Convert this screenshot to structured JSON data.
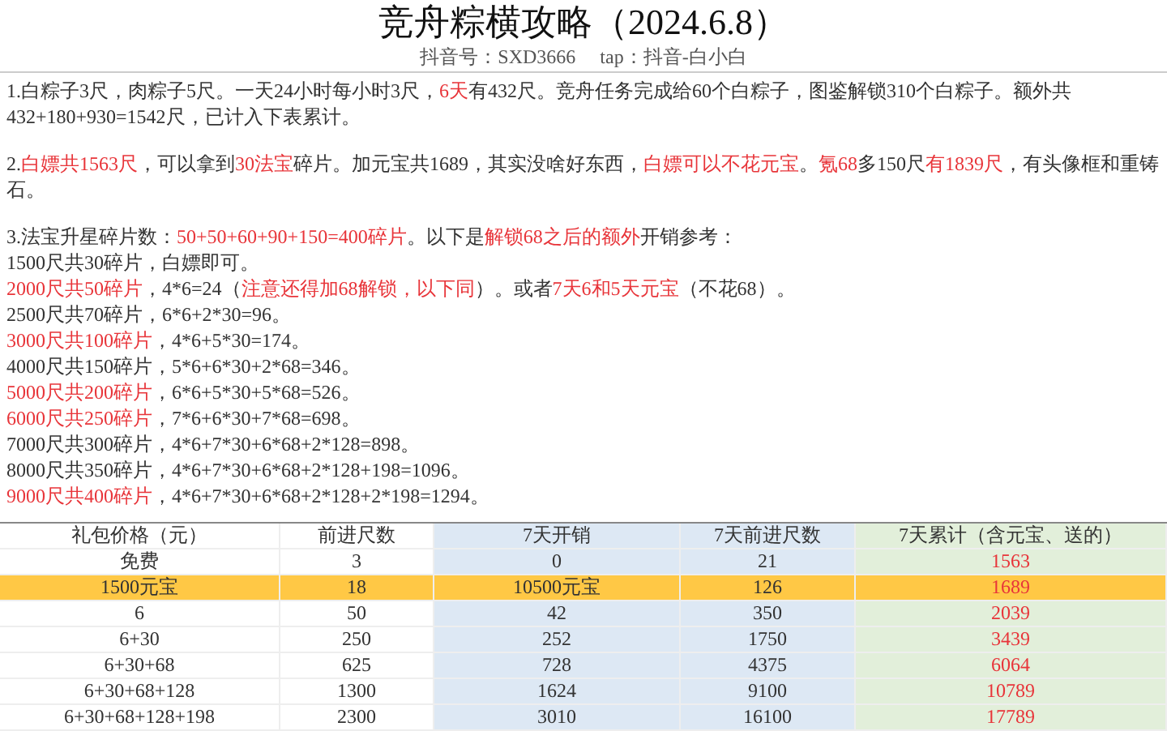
{
  "title": "竞舟粽横攻略（2024.6.8）",
  "subtitle": "抖音号：SXD3666　 tap：抖音-白小白",
  "paragraphs": [
    {
      "lines": [
        [
          {
            "text": "1.白粽子3尺，肉粽子5尺。一天24小时每小时3尺，",
            "highlight": false
          },
          {
            "text": "6天",
            "highlight": true
          },
          {
            "text": "有432尺。竞舟任务完成给60个白粽子，图鉴解锁310个白粽子。额外共432+180+930=1542尺，已计入下表累计。",
            "highlight": false
          }
        ]
      ]
    },
    {
      "lines": [
        [
          {
            "text": "2.",
            "highlight": false
          },
          {
            "text": "白嫖共1563尺",
            "highlight": true
          },
          {
            "text": "，可以拿到",
            "highlight": false
          },
          {
            "text": "30法宝",
            "highlight": true
          },
          {
            "text": "碎片。加元宝共1689，其实没啥好东西，",
            "highlight": false
          },
          {
            "text": "白嫖可以不花元宝",
            "highlight": true
          },
          {
            "text": "。",
            "highlight": false
          },
          {
            "text": "氪68",
            "highlight": true
          },
          {
            "text": "多150尺",
            "highlight": false
          },
          {
            "text": "有1839尺",
            "highlight": true
          },
          {
            "text": "，有头像框和重铸石。",
            "highlight": false
          }
        ]
      ]
    },
    {
      "lines": [
        [
          {
            "text": "3.法宝升星碎片数：",
            "highlight": false
          },
          {
            "text": "50+50+60+90+150=400碎片",
            "highlight": true
          },
          {
            "text": "。以下是",
            "highlight": false
          },
          {
            "text": "解锁68之后的额外",
            "highlight": true
          },
          {
            "text": "开销参考：",
            "highlight": false
          }
        ],
        [
          {
            "text": "1500尺共30碎片，白嫖即可。",
            "highlight": false
          }
        ],
        [
          {
            "text": "2000尺共50碎片",
            "highlight": true
          },
          {
            "text": "，4*6=24（",
            "highlight": false
          },
          {
            "text": "注意还得加68解锁，以下同",
            "highlight": true
          },
          {
            "text": "）。或者",
            "highlight": false
          },
          {
            "text": "7天6和5天元宝",
            "highlight": true
          },
          {
            "text": "（不花68）。",
            "highlight": false
          }
        ],
        [
          {
            "text": "2500尺共70碎片，6*6+2*30=96。",
            "highlight": false
          }
        ],
        [
          {
            "text": "3000尺共100碎片",
            "highlight": true
          },
          {
            "text": "，4*6+5*30=174。",
            "highlight": false
          }
        ],
        [
          {
            "text": "4000尺共150碎片，5*6+6*30+2*68=346。",
            "highlight": false
          }
        ],
        [
          {
            "text": "5000尺共200碎片",
            "highlight": true
          },
          {
            "text": "，6*6+5*30+5*68=526。",
            "highlight": false
          }
        ],
        [
          {
            "text": "6000尺共250碎片",
            "highlight": true
          },
          {
            "text": "，7*6+6*30+7*68=698。",
            "highlight": false
          }
        ],
        [
          {
            "text": "7000尺共300碎片，4*6+7*30+6*68+2*128=898。",
            "highlight": false
          }
        ],
        [
          {
            "text": "8000尺共350碎片，4*6+7*30+6*68+2*128+198=1096。",
            "highlight": false
          }
        ],
        [
          {
            "text": "9000尺共400碎片",
            "highlight": true
          },
          {
            "text": "，4*6+7*30+6*68+2*128+2*198=1294。",
            "highlight": false
          }
        ]
      ]
    }
  ],
  "table": {
    "columns": [
      {
        "label": "礼包价格（元）",
        "color": "#ffffff",
        "emphasis": false
      },
      {
        "label": "前进尺数",
        "color": "#ffffff",
        "emphasis": false
      },
      {
        "label": "7天开销",
        "color": "#dde8f4",
        "emphasis": false
      },
      {
        "label": "7天前进尺数",
        "color": "#dde8f4",
        "emphasis": false
      },
      {
        "label": "7天累计（含元宝、送的）",
        "color": "#e2efda",
        "emphasis": true
      }
    ],
    "rows": [
      {
        "highlighted": false,
        "cells": [
          "免费",
          "3",
          "0",
          "21",
          "1563"
        ]
      },
      {
        "highlighted": true,
        "cells": [
          "1500元宝",
          "18",
          "10500元宝",
          "126",
          "1689"
        ]
      },
      {
        "highlighted": false,
        "cells": [
          "6",
          "50",
          "42",
          "350",
          "2039"
        ]
      },
      {
        "highlighted": false,
        "cells": [
          "6+30",
          "250",
          "252",
          "1750",
          "3439"
        ]
      },
      {
        "highlighted": false,
        "cells": [
          "6+30+68",
          "625",
          "728",
          "4375",
          "6064"
        ]
      },
      {
        "highlighted": false,
        "cells": [
          "6+30+68+128",
          "1300",
          "1624",
          "9100",
          "10789"
        ]
      },
      {
        "highlighted": false,
        "cells": [
          "6+30+68+128+198",
          "2300",
          "3010",
          "16100",
          "17789"
        ]
      }
    ]
  }
}
